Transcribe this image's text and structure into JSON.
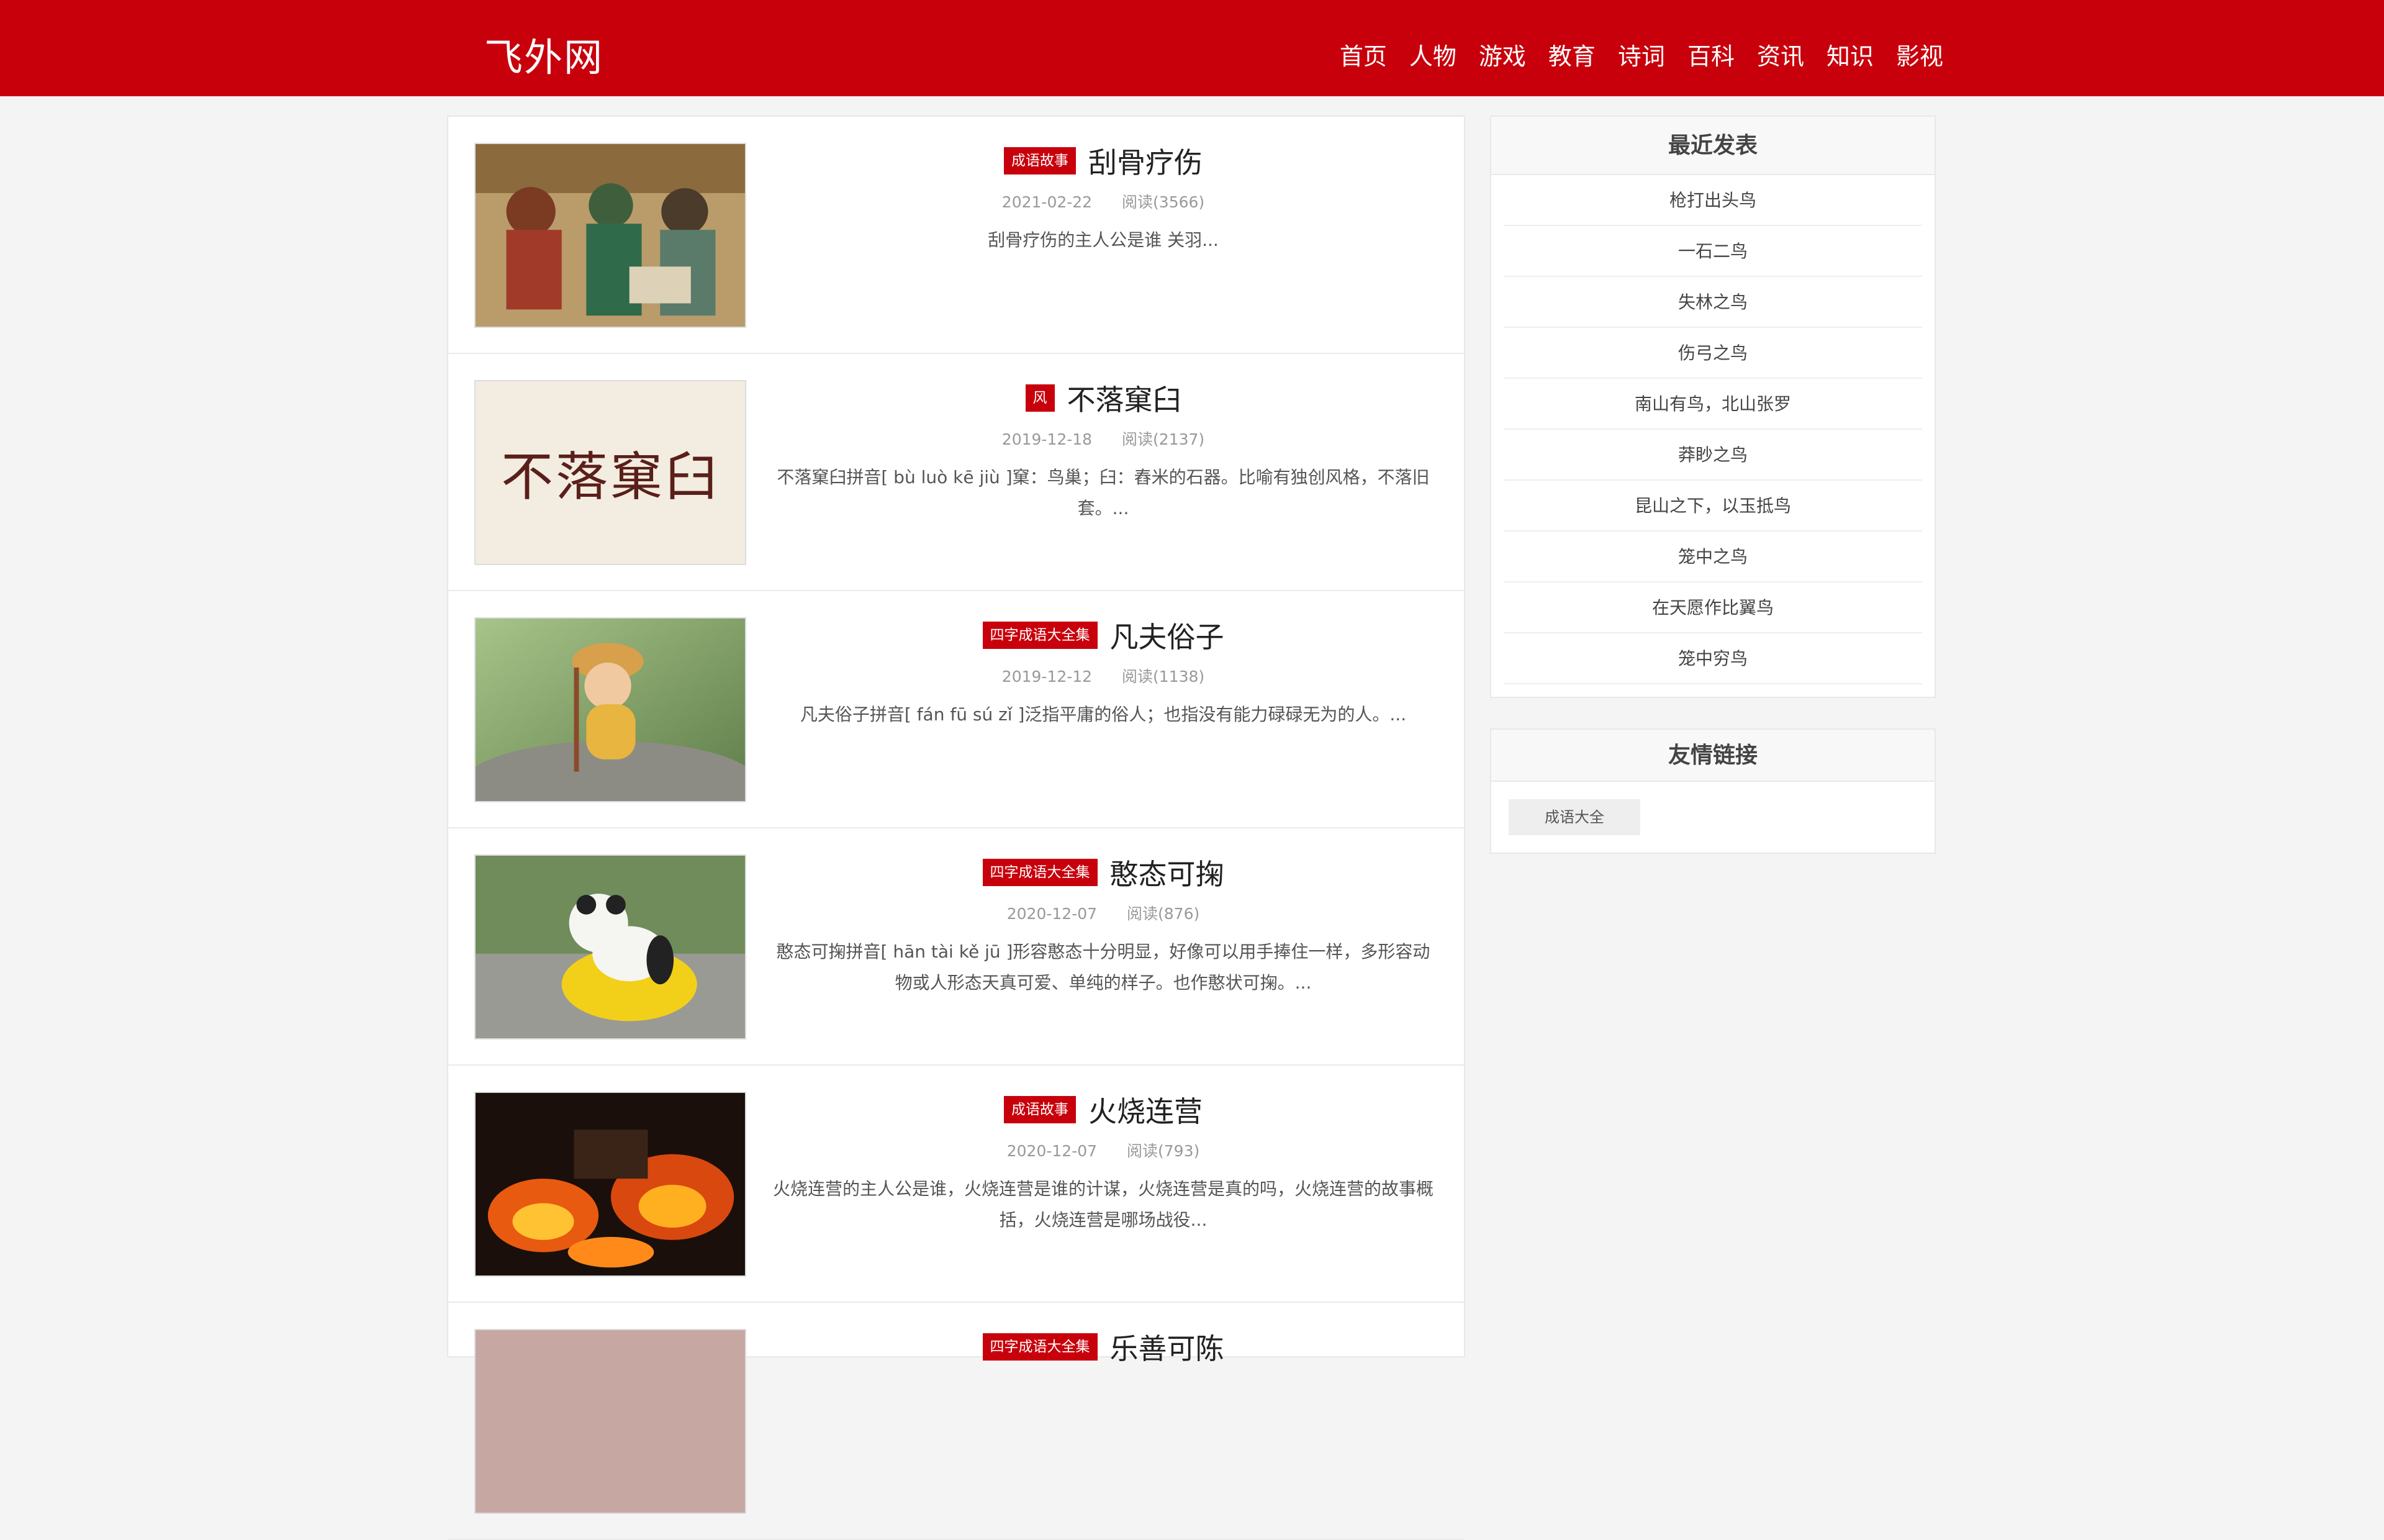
{
  "site": {
    "logo": "飞外网",
    "nav": [
      "首页",
      "人物",
      "游戏",
      "教育",
      "诗词",
      "百科",
      "资讯",
      "知识",
      "影视"
    ]
  },
  "articles": [
    {
      "tag": "成语故事",
      "title": "刮骨疗伤",
      "date": "2021-02-22",
      "reads": "阅读(3566)",
      "desc": "刮骨疗伤的主人公是谁 关羽..."
    },
    {
      "tag": "风",
      "title": "不落窠臼",
      "date": "2019-12-18",
      "reads": "阅读(2137)",
      "desc": "不落窠臼拼音[ bù luò kē jiù ]窠：鸟巢；臼：舂米的石器。比喻有独创风格，不落旧套。..."
    },
    {
      "tag": "四字成语大全集",
      "title": "凡夫俗子",
      "date": "2019-12-12",
      "reads": "阅读(1138)",
      "desc": "凡夫俗子拼音[ fán fū sú zǐ ]泛指平庸的俗人；也指没有能力碌碌无为的人。..."
    },
    {
      "tag": "四字成语大全集",
      "title": "憨态可掬",
      "date": "2020-12-07",
      "reads": "阅读(876)",
      "desc": "憨态可掬拼音[ hān tài kě jū ]形容憨态十分明显，好像可以用手捧住一样，多形容动物或人形态天真可爱、单纯的样子。也作憨状可掬。..."
    },
    {
      "tag": "成语故事",
      "title": "火烧连营",
      "date": "2020-12-07",
      "reads": "阅读(793)",
      "desc": "火烧连营的主人公是谁，火烧连营是谁的计谋，火烧连营是真的吗，火烧连营的故事概括，火烧连营是哪场战役..."
    },
    {
      "tag": "四字成语大全集",
      "title": "乐善可陈",
      "date": "",
      "reads": "",
      "desc": ""
    }
  ],
  "thumb_text": "不落窠臼",
  "sidebar": {
    "recent_title": "最近发表",
    "recent": [
      "枪打出头鸟",
      "一石二鸟",
      "失林之鸟",
      "伤弓之鸟",
      "南山有鸟，北山张罗",
      "莽眇之鸟",
      "昆山之下，以玉抵鸟",
      "笼中之鸟",
      "在天愿作比翼鸟",
      "笼中穷鸟"
    ],
    "links_title": "友情链接",
    "links": [
      "成语大全"
    ]
  },
  "colors": {
    "brand": "#c8000c"
  }
}
